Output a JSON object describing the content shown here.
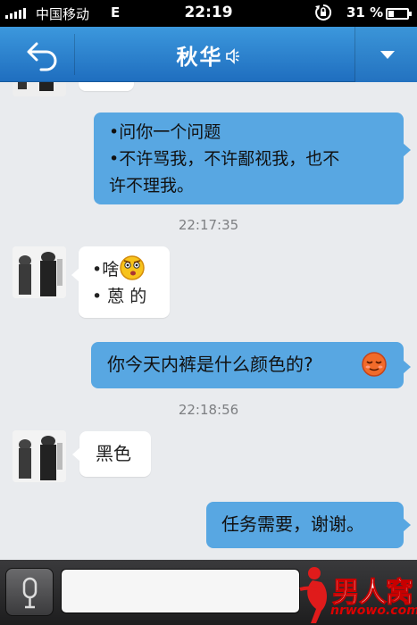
{
  "status_bar": {
    "carrier": "中国移动",
    "network": "E",
    "time": "22:19",
    "battery": "31 %"
  },
  "header": {
    "title": "秋华",
    "back_icon": "back-arrow-icon",
    "menu_icon": "triangle-down-icon"
  },
  "messages": [
    {
      "from": "me",
      "lines": [
        "•问你一个问题",
        "•不许骂我，不许鄙视我，也不",
        "许不理我。"
      ]
    },
    {
      "timestamp": "22:17:35"
    },
    {
      "from": "them",
      "lines": [
        "•啥",
        "• 蒽 的"
      ],
      "emoji": "confused-face"
    },
    {
      "from": "me",
      "text": "你今天内裤是什么颜色的?",
      "emoji": "sleepy-face"
    },
    {
      "timestamp": "22:18:56"
    },
    {
      "from": "them",
      "text": "黑色"
    },
    {
      "from": "me",
      "text": "任务需要，谢谢。"
    }
  ],
  "watermark": {
    "text": "男人窝",
    "url": "nrwowo.com"
  },
  "colors": {
    "header": "#2a80d0",
    "outgoing_bubble": "#58a7e2",
    "incoming_bubble": "#ffffff",
    "chat_background": "#e9ebee"
  }
}
